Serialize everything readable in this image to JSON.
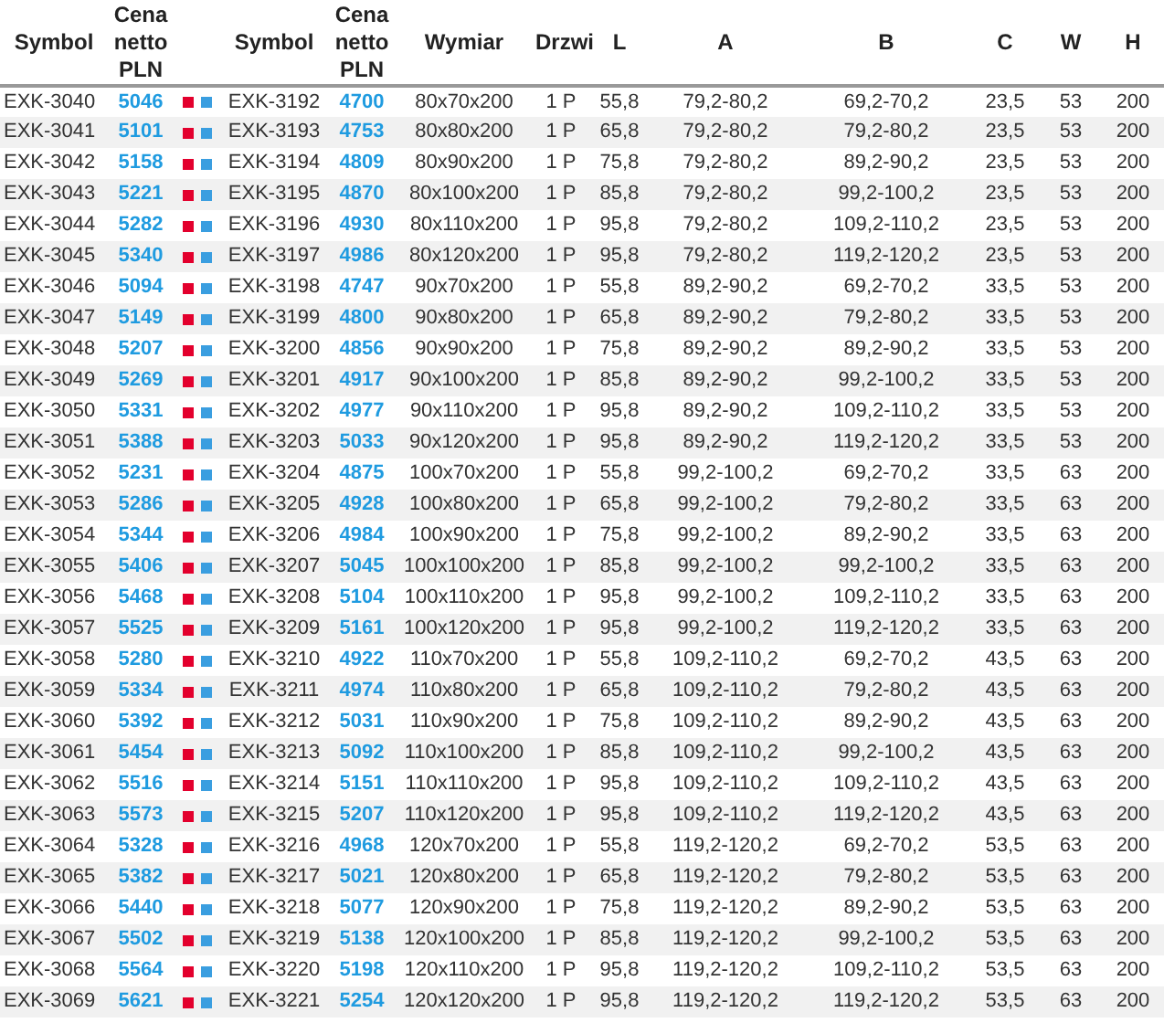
{
  "table": {
    "columns": [
      "Symbol",
      "Cena netto PLN",
      "Symbol",
      "Cena netto PLN",
      "Wymiar",
      "Drzwi",
      "L",
      "A",
      "B",
      "C",
      "W",
      "H"
    ],
    "rows": [
      [
        "EXK-3040",
        "5046",
        "EXK-3192",
        "4700",
        "80x70x200",
        "1 P",
        "55,8",
        "79,2-80,2",
        "69,2-70,2",
        "23,5",
        "53",
        "200"
      ],
      [
        "EXK-3041",
        "5101",
        "EXK-3193",
        "4753",
        "80x80x200",
        "1 P",
        "65,8",
        "79,2-80,2",
        "79,2-80,2",
        "23,5",
        "53",
        "200"
      ],
      [
        "EXK-3042",
        "5158",
        "EXK-3194",
        "4809",
        "80x90x200",
        "1 P",
        "75,8",
        "79,2-80,2",
        "89,2-90,2",
        "23,5",
        "53",
        "200"
      ],
      [
        "EXK-3043",
        "5221",
        "EXK-3195",
        "4870",
        "80x100x200",
        "1 P",
        "85,8",
        "79,2-80,2",
        "99,2-100,2",
        "23,5",
        "53",
        "200"
      ],
      [
        "EXK-3044",
        "5282",
        "EXK-3196",
        "4930",
        "80x110x200",
        "1 P",
        "95,8",
        "79,2-80,2",
        "109,2-110,2",
        "23,5",
        "53",
        "200"
      ],
      [
        "EXK-3045",
        "5340",
        "EXK-3197",
        "4986",
        "80x120x200",
        "1 P",
        "95,8",
        "79,2-80,2",
        "119,2-120,2",
        "23,5",
        "53",
        "200"
      ],
      [
        "EXK-3046",
        "5094",
        "EXK-3198",
        "4747",
        "90x70x200",
        "1 P",
        "55,8",
        "89,2-90,2",
        "69,2-70,2",
        "33,5",
        "53",
        "200"
      ],
      [
        "EXK-3047",
        "5149",
        "EXK-3199",
        "4800",
        "90x80x200",
        "1 P",
        "65,8",
        "89,2-90,2",
        "79,2-80,2",
        "33,5",
        "53",
        "200"
      ],
      [
        "EXK-3048",
        "5207",
        "EXK-3200",
        "4856",
        "90x90x200",
        "1 P",
        "75,8",
        "89,2-90,2",
        "89,2-90,2",
        "33,5",
        "53",
        "200"
      ],
      [
        "EXK-3049",
        "5269",
        "EXK-3201",
        "4917",
        "90x100x200",
        "1 P",
        "85,8",
        "89,2-90,2",
        "99,2-100,2",
        "33,5",
        "53",
        "200"
      ],
      [
        "EXK-3050",
        "5331",
        "EXK-3202",
        "4977",
        "90x110x200",
        "1 P",
        "95,8",
        "89,2-90,2",
        "109,2-110,2",
        "33,5",
        "53",
        "200"
      ],
      [
        "EXK-3051",
        "5388",
        "EXK-3203",
        "5033",
        "90x120x200",
        "1 P",
        "95,8",
        "89,2-90,2",
        "119,2-120,2",
        "33,5",
        "53",
        "200"
      ],
      [
        "EXK-3052",
        "5231",
        "EXK-3204",
        "4875",
        "100x70x200",
        "1 P",
        "55,8",
        "99,2-100,2",
        "69,2-70,2",
        "33,5",
        "63",
        "200"
      ],
      [
        "EXK-3053",
        "5286",
        "EXK-3205",
        "4928",
        "100x80x200",
        "1 P",
        "65,8",
        "99,2-100,2",
        "79,2-80,2",
        "33,5",
        "63",
        "200"
      ],
      [
        "EXK-3054",
        "5344",
        "EXK-3206",
        "4984",
        "100x90x200",
        "1 P",
        "75,8",
        "99,2-100,2",
        "89,2-90,2",
        "33,5",
        "63",
        "200"
      ],
      [
        "EXK-3055",
        "5406",
        "EXK-3207",
        "5045",
        "100x100x200",
        "1 P",
        "85,8",
        "99,2-100,2",
        "99,2-100,2",
        "33,5",
        "63",
        "200"
      ],
      [
        "EXK-3056",
        "5468",
        "EXK-3208",
        "5104",
        "100x110x200",
        "1 P",
        "95,8",
        "99,2-100,2",
        "109,2-110,2",
        "33,5",
        "63",
        "200"
      ],
      [
        "EXK-3057",
        "5525",
        "EXK-3209",
        "5161",
        "100x120x200",
        "1 P",
        "95,8",
        "99,2-100,2",
        "119,2-120,2",
        "33,5",
        "63",
        "200"
      ],
      [
        "EXK-3058",
        "5280",
        "EXK-3210",
        "4922",
        "110x70x200",
        "1 P",
        "55,8",
        "109,2-110,2",
        "69,2-70,2",
        "43,5",
        "63",
        "200"
      ],
      [
        "EXK-3059",
        "5334",
        "EXK-3211",
        "4974",
        "110x80x200",
        "1 P",
        "65,8",
        "109,2-110,2",
        "79,2-80,2",
        "43,5",
        "63",
        "200"
      ],
      [
        "EXK-3060",
        "5392",
        "EXK-3212",
        "5031",
        "110x90x200",
        "1 P",
        "75,8",
        "109,2-110,2",
        "89,2-90,2",
        "43,5",
        "63",
        "200"
      ],
      [
        "EXK-3061",
        "5454",
        "EXK-3213",
        "5092",
        "110x100x200",
        "1 P",
        "85,8",
        "109,2-110,2",
        "99,2-100,2",
        "43,5",
        "63",
        "200"
      ],
      [
        "EXK-3062",
        "5516",
        "EXK-3214",
        "5151",
        "110x110x200",
        "1 P",
        "95,8",
        "109,2-110,2",
        "109,2-110,2",
        "43,5",
        "63",
        "200"
      ],
      [
        "EXK-3063",
        "5573",
        "EXK-3215",
        "5207",
        "110x120x200",
        "1 P",
        "95,8",
        "109,2-110,2",
        "119,2-120,2",
        "43,5",
        "63",
        "200"
      ],
      [
        "EXK-3064",
        "5328",
        "EXK-3216",
        "4968",
        "120x70x200",
        "1 P",
        "55,8",
        "119,2-120,2",
        "69,2-70,2",
        "53,5",
        "63",
        "200"
      ],
      [
        "EXK-3065",
        "5382",
        "EXK-3217",
        "5021",
        "120x80x200",
        "1 P",
        "65,8",
        "119,2-120,2",
        "79,2-80,2",
        "53,5",
        "63",
        "200"
      ],
      [
        "EXK-3066",
        "5440",
        "EXK-3218",
        "5077",
        "120x90x200",
        "1 P",
        "75,8",
        "119,2-120,2",
        "89,2-90,2",
        "53,5",
        "63",
        "200"
      ],
      [
        "EXK-3067",
        "5502",
        "EXK-3219",
        "5138",
        "120x100x200",
        "1 P",
        "85,8",
        "119,2-120,2",
        "99,2-100,2",
        "53,5",
        "63",
        "200"
      ],
      [
        "EXK-3068",
        "5564",
        "EXK-3220",
        "5198",
        "120x110x200",
        "1 P",
        "95,8",
        "119,2-120,2",
        "109,2-110,2",
        "53,5",
        "63",
        "200"
      ],
      [
        "EXK-3069",
        "5621",
        "EXK-3221",
        "5254",
        "120x120x200",
        "1 P",
        "95,8",
        "119,2-120,2",
        "119,2-120,2",
        "53,5",
        "63",
        "200"
      ]
    ]
  }
}
